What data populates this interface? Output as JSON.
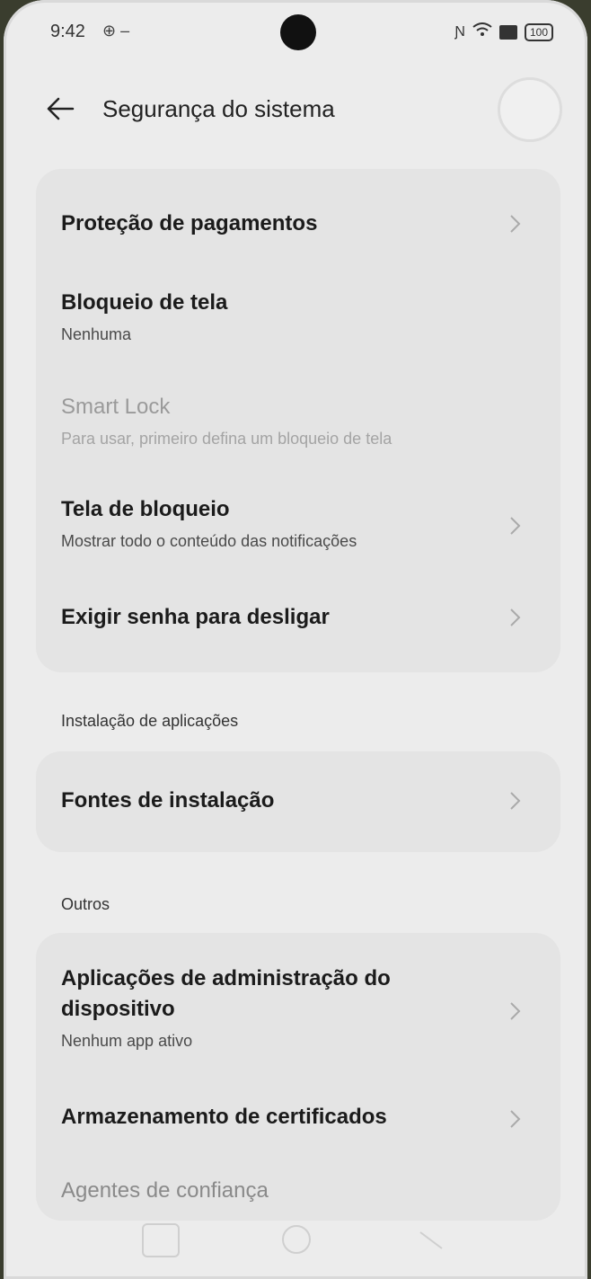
{
  "status": {
    "time": "9:42",
    "battery": "100"
  },
  "header": {
    "title": "Segurança do sistema"
  },
  "items": [
    {
      "label": "Proteção de pagamentos",
      "sub": ""
    },
    {
      "label": "Bloqueio de tela",
      "sub": "Nenhuma"
    },
    {
      "label": "Smart Lock",
      "sub": "Para usar, primeiro defina um bloqueio de tela"
    },
    {
      "label": "Tela de bloqueio",
      "sub": "Mostrar todo o conteúdo das notificações"
    },
    {
      "label": "Exigir senha para desligar",
      "sub": ""
    }
  ],
  "section_install": {
    "title": "Instalação de aplicações",
    "items": [
      {
        "label": "Fontes de instalação"
      }
    ]
  },
  "section_others": {
    "title": "Outros",
    "items": [
      {
        "label": "Aplicações de administração do dispositivo",
        "sub": "Nenhum app ativo"
      },
      {
        "label": "Armazenamento de certificados"
      },
      {
        "label": "Agentes de confiança"
      }
    ]
  }
}
